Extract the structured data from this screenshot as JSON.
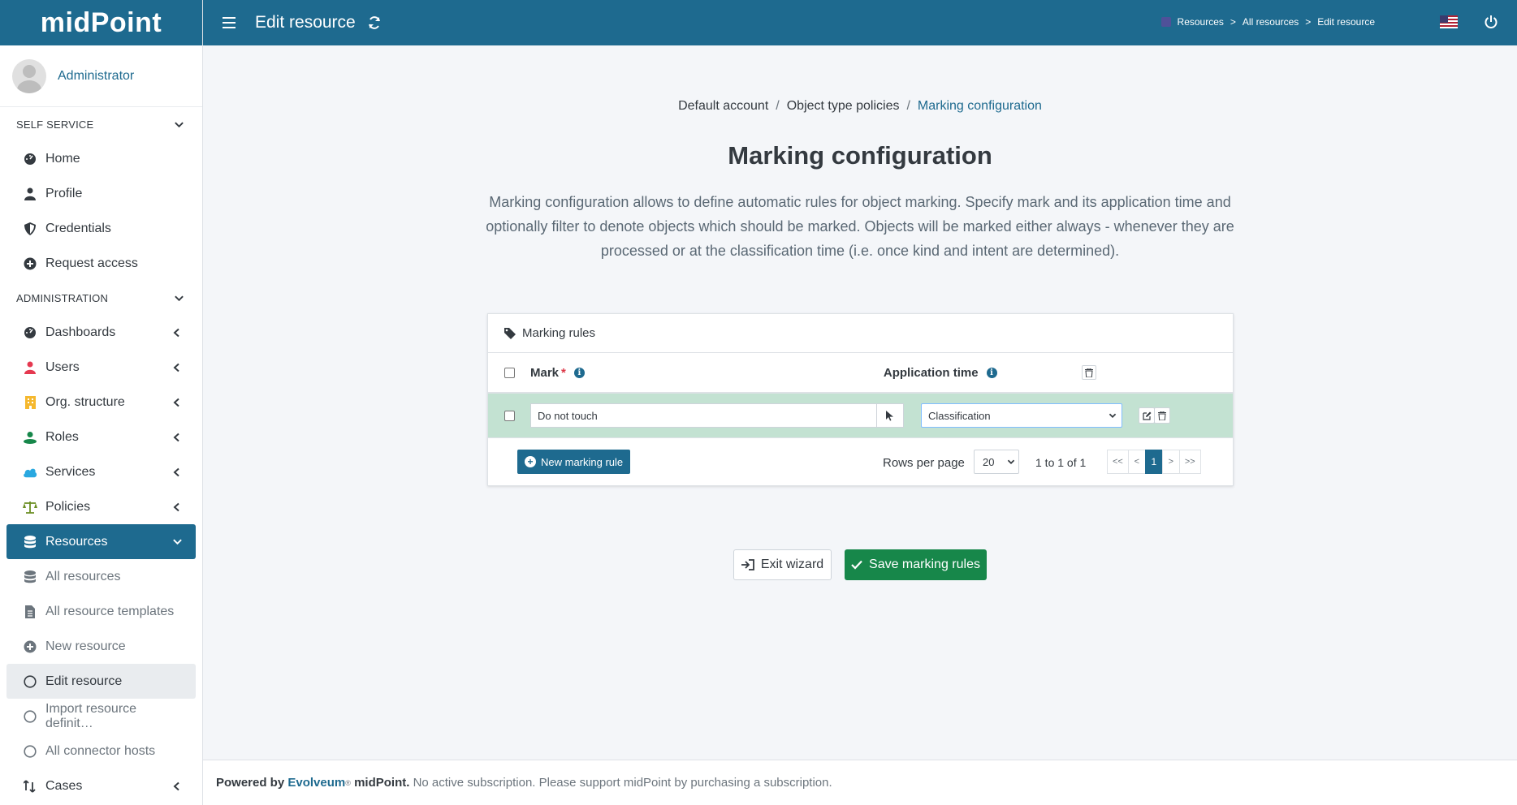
{
  "brand": {
    "logo": "midPoint"
  },
  "user": {
    "name": "Administrator"
  },
  "nav": {
    "self_service_header": "SELF SERVICE",
    "self_service_items": [
      "Home",
      "Profile",
      "Credentials",
      "Request access"
    ],
    "admin_header": "ADMINISTRATION",
    "admin_items": [
      "Dashboards",
      "Users",
      "Org. structure",
      "Roles",
      "Services",
      "Policies",
      "Resources"
    ],
    "resource_sub_items": [
      "All resources",
      "All resource templates",
      "New resource",
      "Edit resource",
      "Import resource definit…",
      "All connector hosts"
    ],
    "cases": "Cases"
  },
  "header": {
    "title": "Edit resource",
    "breadcrumb": [
      "Resources",
      "All resources",
      "Edit resource"
    ],
    "breadcrumb_sep": ">"
  },
  "content": {
    "breadcrumb": [
      "Default account",
      "Object type policies",
      "Marking configuration"
    ],
    "title": "Marking configuration",
    "description": "Marking configuration allows to define automatic rules for object marking. Specify mark and its application time and optionally filter to denote objects which should be marked. Objects will be marked either always - whenever they are processed or at the classification time (i.e. once kind and intent are determined).",
    "panel_title": "Marking rules",
    "columns": {
      "mark": "Mark",
      "required": "*",
      "application_time": "Application time"
    },
    "rows": [
      {
        "mark": "Do not touch",
        "application_time": "Classification"
      }
    ],
    "new_rule_button": "New marking rule",
    "rows_per_page_label": "Rows per page",
    "rows_per_page_value": "20",
    "range_text": "1 to 1 of 1",
    "pager": [
      "<<",
      "<",
      "1",
      ">",
      ">>"
    ],
    "exit_button": "Exit wizard",
    "save_button": "Save marking rules"
  },
  "footer": {
    "powered_by": "Powered by",
    "company": "Evolveum",
    "reg": "®",
    "product": "midPoint.",
    "message": "No active subscription. Please support midPoint by purchasing a subscription."
  },
  "colors": {
    "primary": "#1e6a8f",
    "success": "#17874a",
    "row_highlight": "#c3e2d2"
  }
}
